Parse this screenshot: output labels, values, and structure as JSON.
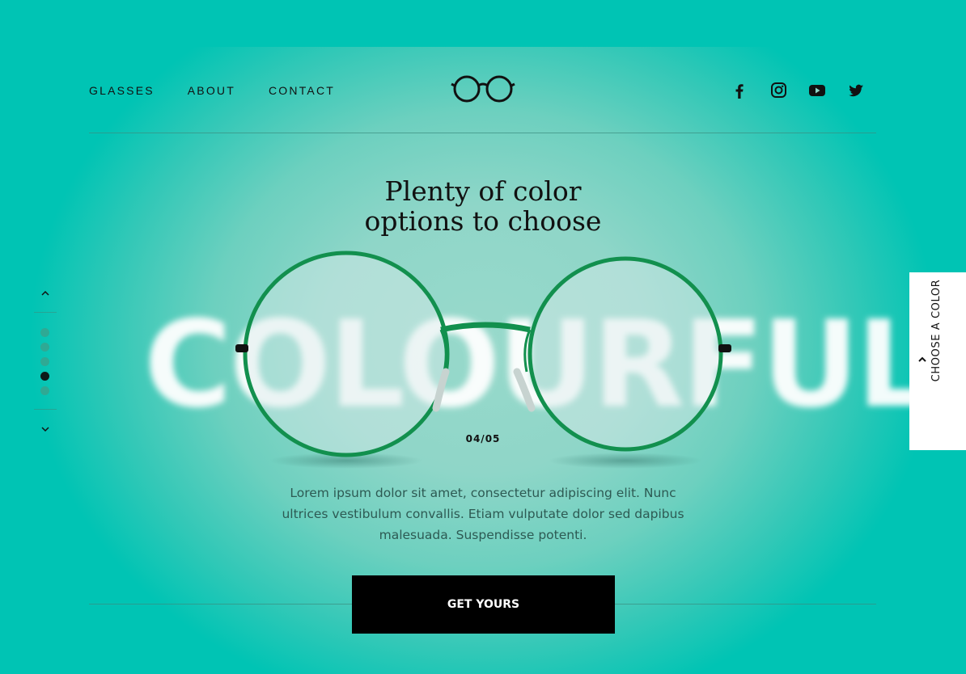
{
  "nav": {
    "items": [
      "GLASSES",
      "ABOUT",
      "CONTACT"
    ]
  },
  "logo": {
    "icon": "glasses-logo-icon"
  },
  "social": [
    "facebook-icon",
    "instagram-icon",
    "youtube-icon",
    "twitter-icon"
  ],
  "hero": {
    "heading_line1": "Plenty of color",
    "heading_line2": "options to choose",
    "big_word": "COLOURFUL",
    "counter": "04/05",
    "description": "Lorem ipsum dolor sit amet, consectetur adipiscing elit. Nunc ultrices vestibulum convallis. Etiam vulputate dolor sed dapibus malesuada. Suspendisse potenti.",
    "cta_label": "GET YOURS"
  },
  "pager": {
    "total": 5,
    "active_index": 3
  },
  "color_panel": {
    "label": "CHOOSE A COLOR"
  },
  "colors": {
    "background": "#00c4b4",
    "frame": "#12904e",
    "text": "#111111",
    "cta": "#000000"
  }
}
